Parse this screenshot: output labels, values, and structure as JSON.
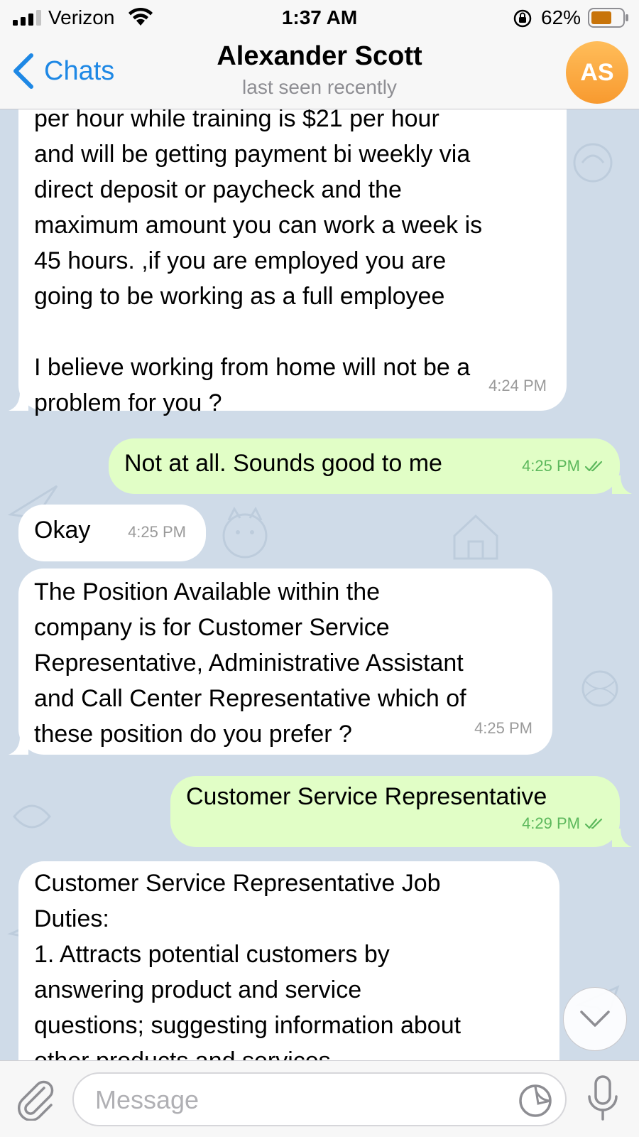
{
  "status_bar": {
    "carrier": "Verizon",
    "time": "1:37 AM",
    "battery": "62%"
  },
  "header": {
    "back_label": "Chats",
    "contact_name": "Alexander Scott",
    "contact_status": "last seen recently",
    "avatar_initials": "AS"
  },
  "messages": [
    {
      "direction": "incoming",
      "text": "per hour while training is $21 per hour\nand will be getting payment bi weekly via\ndirect deposit or paycheck and the\nmaximum amount you can work a week is\n45 hours. ,if you are employed you are\ngoing to be working as a full employee\n\nI believe working from home will not be a\nproblem for you ?",
      "time": "4:24 PM"
    },
    {
      "direction": "outgoing",
      "text": "Not at all. Sounds good to me",
      "time": "4:25 PM",
      "read": true
    },
    {
      "direction": "incoming",
      "text": "Okay",
      "time": "4:25 PM"
    },
    {
      "direction": "incoming",
      "text": "The Position Available within the\ncompany is for Customer Service\nRepresentative, Administrative Assistant\nand Call Center Representative which of\nthese position do you prefer ?",
      "time": "4:25 PM"
    },
    {
      "direction": "outgoing",
      "text": "Customer Service Representative",
      "time": "4:29 PM",
      "read": true
    },
    {
      "direction": "incoming",
      "text": "Customer Service Representative Job\nDuties:\n1. Attracts potential customers by\nanswering product and service\nquestions; suggesting information about\nother products and services."
    }
  ],
  "input": {
    "placeholder": "Message"
  },
  "colors": {
    "accent": "#1e88e5",
    "chat_background": "#cfdbe8",
    "incoming_bubble": "#ffffff",
    "outgoing_bubble": "#e1fec6",
    "outgoing_time": "#5cb85c",
    "avatar": "#f89a2f"
  },
  "icons": [
    "signal-icon",
    "wifi-icon",
    "orientation-lock-icon",
    "battery-icon",
    "back-chevron-icon",
    "double-check-icon",
    "scroll-down-chevron-icon",
    "paperclip-icon",
    "sticker-icon",
    "microphone-icon"
  ]
}
